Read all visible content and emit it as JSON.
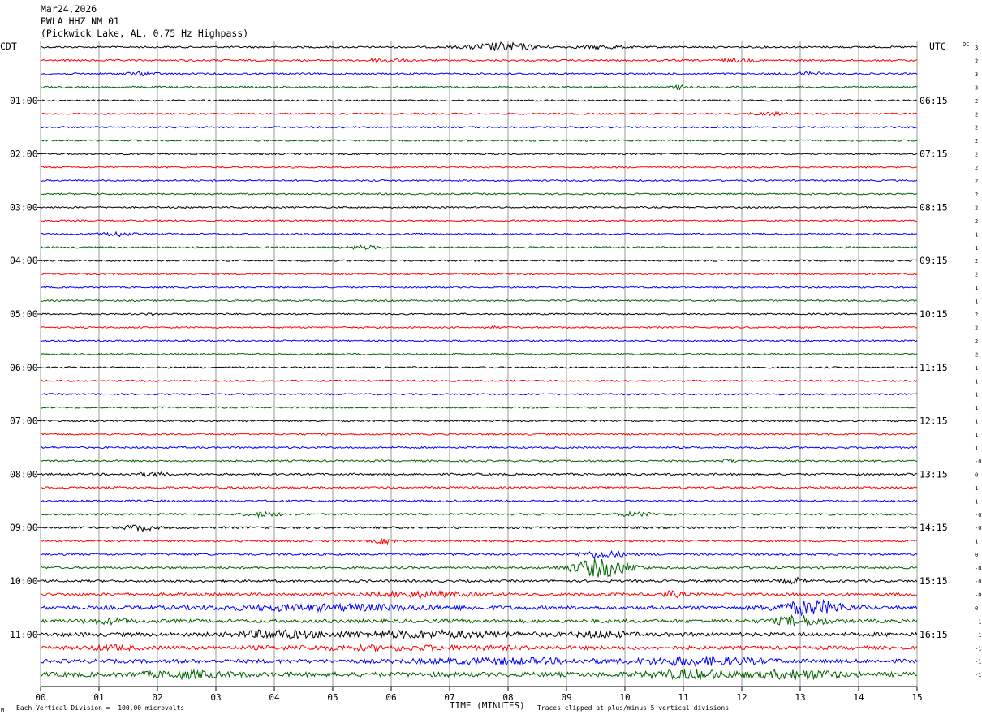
{
  "header": {
    "date": "Mar24,2026",
    "station": "PWLA HHZ NM 01",
    "location": "(Pickwick Lake, AL, 0.75 Hz Highpass)"
  },
  "left_timezone": "CDT",
  "right_timezone": "UTC",
  "dc_label": "DC",
  "footer": {
    "scale_note": "Each Vertical Division =  100.00 microvolts",
    "clip_note": "Traces clipped at plus/minus 5 vertical divisions",
    "corner_mark": "M"
  },
  "colors": {
    "trace_cycle": [
      "#000000",
      "#ff0000",
      "#0000ff",
      "#006400"
    ],
    "grid": "#999999"
  },
  "chart_data": {
    "type": "line",
    "title": "PWLA HHZ NM 01",
    "xlabel": "TIME (MINUTES)",
    "ylabel": "",
    "x_range": [
      0,
      15
    ],
    "x_ticks": [
      "00",
      "01",
      "02",
      "03",
      "04",
      "05",
      "06",
      "07",
      "08",
      "09",
      "10",
      "11",
      "12",
      "13",
      "14",
      "15"
    ],
    "line_minutes": 15,
    "line_count": 48,
    "left_hour_labels": [
      {
        "line": 4,
        "label": "01:00"
      },
      {
        "line": 8,
        "label": "02:00"
      },
      {
        "line": 12,
        "label": "03:00"
      },
      {
        "line": 16,
        "label": "04:00"
      },
      {
        "line": 20,
        "label": "05:00"
      },
      {
        "line": 24,
        "label": "06:00"
      },
      {
        "line": 28,
        "label": "07:00"
      },
      {
        "line": 32,
        "label": "08:00"
      },
      {
        "line": 36,
        "label": "09:00"
      },
      {
        "line": 40,
        "label": "10:00"
      },
      {
        "line": 44,
        "label": "11:00"
      }
    ],
    "right_hour_labels": [
      {
        "line": 4,
        "label": "06:15"
      },
      {
        "line": 8,
        "label": "07:15"
      },
      {
        "line": 12,
        "label": "08:15"
      },
      {
        "line": 16,
        "label": "09:15"
      },
      {
        "line": 20,
        "label": "10:15"
      },
      {
        "line": 24,
        "label": "11:15"
      },
      {
        "line": 28,
        "label": "12:15"
      },
      {
        "line": 32,
        "label": "13:15"
      },
      {
        "line": 36,
        "label": "14:15"
      },
      {
        "line": 40,
        "label": "15:15"
      },
      {
        "line": 44,
        "label": "16:15"
      }
    ],
    "dc_offsets": [
      "3",
      "2",
      "3",
      "3",
      "2",
      "2",
      "2",
      "2",
      "2",
      "2",
      "2",
      "2",
      "2",
      "2",
      "1",
      "1",
      "2",
      "2",
      "1",
      "1",
      "2",
      "2",
      "2",
      "2",
      "1",
      "1",
      "1",
      "1",
      "1",
      "1",
      "1",
      "-0",
      "0",
      "1",
      "1",
      "-0",
      "-0",
      "1",
      "0",
      "-0",
      "-0",
      "-0",
      "0",
      "-1",
      "-1",
      "-1",
      "-1",
      "-1"
    ],
    "series": [
      {
        "line": 0,
        "amplitude": 0.5,
        "events": [
          {
            "t": 7.9,
            "a": 2.2,
            "w": 0.55
          },
          {
            "t": 9.6,
            "a": 0.8,
            "w": 0.4
          }
        ]
      },
      {
        "line": 1,
        "amplitude": 0.5,
        "events": [
          {
            "t": 5.9,
            "a": 1.2,
            "w": 0.3
          },
          {
            "t": 11.9,
            "a": 0.8,
            "w": 0.3
          }
        ]
      },
      {
        "line": 2,
        "amplitude": 0.5,
        "events": [
          {
            "t": 1.7,
            "a": 0.8,
            "w": 0.3
          },
          {
            "t": 13.1,
            "a": 0.8,
            "w": 0.3
          }
        ]
      },
      {
        "line": 3,
        "amplitude": 0.5,
        "events": [
          {
            "t": 10.9,
            "a": 1.2,
            "w": 0.1
          }
        ]
      },
      {
        "line": 4,
        "amplitude": 0.45,
        "events": []
      },
      {
        "line": 5,
        "amplitude": 0.45,
        "events": [
          {
            "t": 12.5,
            "a": 0.7,
            "w": 0.3
          }
        ]
      },
      {
        "line": 6,
        "amplitude": 0.45,
        "events": []
      },
      {
        "line": 7,
        "amplitude": 0.45,
        "events": []
      },
      {
        "line": 8,
        "amplitude": 0.45,
        "events": []
      },
      {
        "line": 9,
        "amplitude": 0.45,
        "events": []
      },
      {
        "line": 10,
        "amplitude": 0.45,
        "events": []
      },
      {
        "line": 11,
        "amplitude": 0.45,
        "events": []
      },
      {
        "line": 12,
        "amplitude": 0.45,
        "events": []
      },
      {
        "line": 13,
        "amplitude": 0.45,
        "events": []
      },
      {
        "line": 14,
        "amplitude": 0.45,
        "events": [
          {
            "t": 1.3,
            "a": 1.2,
            "w": 0.25
          }
        ]
      },
      {
        "line": 15,
        "amplitude": 0.45,
        "events": [
          {
            "t": 5.5,
            "a": 0.8,
            "w": 0.35
          }
        ]
      },
      {
        "line": 16,
        "amplitude": 0.45,
        "events": []
      },
      {
        "line": 17,
        "amplitude": 0.45,
        "events": []
      },
      {
        "line": 18,
        "amplitude": 0.45,
        "events": []
      },
      {
        "line": 19,
        "amplitude": 0.45,
        "events": []
      },
      {
        "line": 20,
        "amplitude": 0.45,
        "events": [
          {
            "t": 1.9,
            "a": 0.6,
            "w": 0.1
          }
        ]
      },
      {
        "line": 21,
        "amplitude": 0.45,
        "events": [
          {
            "t": 7.7,
            "a": 0.5,
            "w": 0.15
          }
        ]
      },
      {
        "line": 22,
        "amplitude": 0.45,
        "events": []
      },
      {
        "line": 23,
        "amplitude": 0.45,
        "events": []
      },
      {
        "line": 24,
        "amplitude": 0.45,
        "events": []
      },
      {
        "line": 25,
        "amplitude": 0.45,
        "events": []
      },
      {
        "line": 26,
        "amplitude": 0.45,
        "events": []
      },
      {
        "line": 27,
        "amplitude": 0.45,
        "events": []
      },
      {
        "line": 28,
        "amplitude": 0.5,
        "events": []
      },
      {
        "line": 29,
        "amplitude": 0.5,
        "events": []
      },
      {
        "line": 30,
        "amplitude": 0.5,
        "events": []
      },
      {
        "line": 31,
        "amplitude": 0.5,
        "events": [
          {
            "t": 11.8,
            "a": 1.0,
            "w": 0.15
          }
        ]
      },
      {
        "line": 32,
        "amplitude": 0.55,
        "events": [
          {
            "t": 1.9,
            "a": 0.9,
            "w": 0.3
          }
        ]
      },
      {
        "line": 33,
        "amplitude": 0.55,
        "events": []
      },
      {
        "line": 34,
        "amplitude": 0.55,
        "events": []
      },
      {
        "line": 35,
        "amplitude": 0.55,
        "events": [
          {
            "t": 3.8,
            "a": 1.0,
            "w": 0.3
          },
          {
            "t": 10.2,
            "a": 0.9,
            "w": 0.4
          }
        ]
      },
      {
        "line": 36,
        "amplitude": 0.6,
        "events": [
          {
            "t": 1.7,
            "a": 1.6,
            "w": 0.25
          }
        ]
      },
      {
        "line": 37,
        "amplitude": 0.55,
        "events": [
          {
            "t": 5.9,
            "a": 1.2,
            "w": 0.2
          }
        ]
      },
      {
        "line": 38,
        "amplitude": 0.6,
        "events": [
          {
            "t": 9.6,
            "a": 1.6,
            "w": 0.4
          }
        ]
      },
      {
        "line": 39,
        "amplitude": 0.6,
        "events": [
          {
            "t": 9.6,
            "a": 5.0,
            "w": 0.5
          }
        ]
      },
      {
        "line": 40,
        "amplitude": 0.65,
        "events": [
          {
            "t": 12.9,
            "a": 1.5,
            "w": 0.2
          }
        ]
      },
      {
        "line": 41,
        "amplitude": 0.8,
        "events": [
          {
            "t": 6.5,
            "a": 1.3,
            "w": 0.8
          },
          {
            "t": 10.8,
            "a": 1.3,
            "w": 0.2
          }
        ]
      },
      {
        "line": 42,
        "amplitude": 1.0,
        "events": [
          {
            "t": 5.0,
            "a": 1.3,
            "w": 2.0
          },
          {
            "t": 13.2,
            "a": 3.5,
            "w": 0.6
          }
        ]
      },
      {
        "line": 43,
        "amplitude": 1.0,
        "events": [
          {
            "t": 1.2,
            "a": 1.0,
            "w": 0.4
          },
          {
            "t": 13.0,
            "a": 2.5,
            "w": 0.4
          }
        ]
      },
      {
        "line": 44,
        "amplitude": 1.1,
        "events": [
          {
            "t": 4.0,
            "a": 1.8,
            "w": 0.6
          },
          {
            "t": 6.5,
            "a": 1.5,
            "w": 1.5
          },
          {
            "t": 9.6,
            "a": 1.4,
            "w": 0.4
          }
        ]
      },
      {
        "line": 45,
        "amplitude": 1.0,
        "events": [
          {
            "t": 1.2,
            "a": 1.0,
            "w": 0.4
          },
          {
            "t": 6.0,
            "a": 0.8,
            "w": 2.0
          }
        ]
      },
      {
        "line": 46,
        "amplitude": 1.1,
        "events": [
          {
            "t": 8.0,
            "a": 1.0,
            "w": 1.5
          },
          {
            "t": 11.3,
            "a": 1.8,
            "w": 1.0
          }
        ]
      },
      {
        "line": 47,
        "amplitude": 1.3,
        "events": [
          {
            "t": 2.5,
            "a": 1.3,
            "w": 0.7
          },
          {
            "t": 11.2,
            "a": 1.7,
            "w": 0.8
          },
          {
            "t": 13.0,
            "a": 2.0,
            "w": 0.6
          }
        ]
      }
    ]
  }
}
